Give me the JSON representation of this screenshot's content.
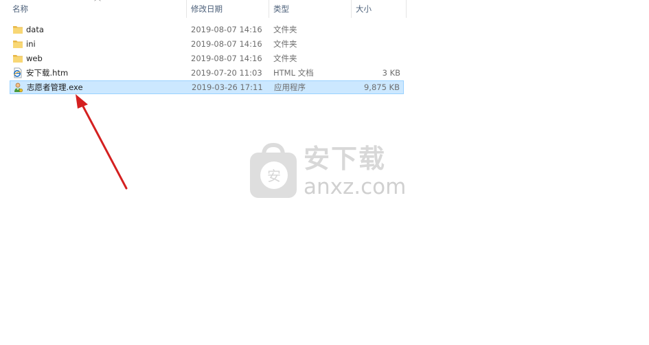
{
  "columns": {
    "name": "名称",
    "date": "修改日期",
    "type": "类型",
    "size": "大小"
  },
  "files": [
    {
      "name": "data",
      "date": "2019-08-07 14:16",
      "type": "文件夹",
      "size": "",
      "icon": "folder-icon"
    },
    {
      "name": "ini",
      "date": "2019-08-07 14:16",
      "type": "文件夹",
      "size": "",
      "icon": "folder-icon"
    },
    {
      "name": "web",
      "date": "2019-08-07 14:16",
      "type": "文件夹",
      "size": "",
      "icon": "folder-icon"
    },
    {
      "name": "安下载.htm",
      "date": "2019-07-20 11:03",
      "type": "HTML 文档",
      "size": "3 KB",
      "icon": "html-document-icon"
    },
    {
      "name": "志愿者管理.exe",
      "date": "2019-03-26 17:11",
      "type": "应用程序",
      "size": "9,875 KB",
      "icon": "application-icon",
      "selected": true
    }
  ],
  "watermark": {
    "title": "安下载",
    "domain": "anxz.com",
    "badge": "安"
  },
  "colors": {
    "selection_bg": "#cce8ff",
    "selection_border": "#99d1ff",
    "arrow": "#d42020",
    "folder": "#f8d775"
  }
}
